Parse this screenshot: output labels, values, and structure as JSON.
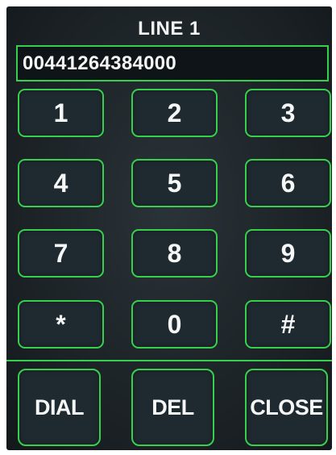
{
  "header": {
    "title": "LINE 1"
  },
  "display": {
    "number": "00441264384000"
  },
  "keypad": {
    "keys": [
      "1",
      "2",
      "3",
      "4",
      "5",
      "6",
      "7",
      "8",
      "9",
      "*",
      "0",
      "#"
    ]
  },
  "actions": {
    "dial": "DIAL",
    "delete": "DEL",
    "close": "CLOSE"
  },
  "colors": {
    "accent": "#37d04c",
    "background": "#1a2024",
    "text": "#f5f7f7"
  }
}
